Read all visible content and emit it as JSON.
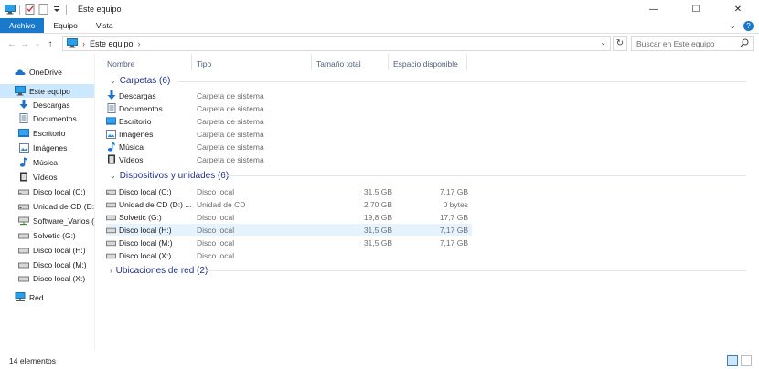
{
  "window": {
    "title": "Este equipo",
    "controls": {
      "minimize": "—",
      "maximize": "☐",
      "close": "✕"
    }
  },
  "ribbon": {
    "tabs": [
      {
        "label": "Archivo",
        "active": true
      },
      {
        "label": "Equipo",
        "active": false
      },
      {
        "label": "Vista",
        "active": false
      }
    ],
    "help": "?"
  },
  "address": {
    "path": "Este equipo",
    "separator": "›",
    "search_placeholder": "Buscar en Este equipo"
  },
  "nav": {
    "items": [
      {
        "label": "OneDrive",
        "icon": "cloud-icon"
      },
      {
        "label": "Este equipo",
        "icon": "computer-icon",
        "selected": true
      },
      {
        "label": "Descargas",
        "icon": "download-icon"
      },
      {
        "label": "Documentos",
        "icon": "document-icon"
      },
      {
        "label": "Escritorio",
        "icon": "desktop-icon"
      },
      {
        "label": "Imágenes",
        "icon": "picture-icon"
      },
      {
        "label": "Música",
        "icon": "music-icon"
      },
      {
        "label": "Vídeos",
        "icon": "video-icon"
      },
      {
        "label": "Disco local (C:)",
        "icon": "drive-icon"
      },
      {
        "label": "Unidad de CD (D:) C",
        "icon": "drive-icon"
      },
      {
        "label": "Software_Varios (\\\\v",
        "icon": "network-drive-icon"
      },
      {
        "label": "Solvetic (G:)",
        "icon": "drive-icon"
      },
      {
        "label": "Disco local (H:)",
        "icon": "drive-icon"
      },
      {
        "label": "Disco local (M:)",
        "icon": "drive-icon"
      },
      {
        "label": "Disco local (X:)",
        "icon": "drive-icon"
      },
      {
        "label": "Red",
        "icon": "network-icon"
      }
    ]
  },
  "columns": {
    "name": "Nombre",
    "type": "Tipo",
    "total": "Tamaño total",
    "free": "Espacio disponible"
  },
  "groups": {
    "folders": {
      "title": "Carpetas (6)",
      "items": [
        {
          "name": "Descargas",
          "type": "Carpeta de sistema",
          "icon": "download-icon"
        },
        {
          "name": "Documentos",
          "type": "Carpeta de sistema",
          "icon": "document-icon"
        },
        {
          "name": "Escritorio",
          "type": "Carpeta de sistema",
          "icon": "desktop-icon"
        },
        {
          "name": "Imágenes",
          "type": "Carpeta de sistema",
          "icon": "picture-icon"
        },
        {
          "name": "Música",
          "type": "Carpeta de sistema",
          "icon": "music-icon"
        },
        {
          "name": "Vídeos",
          "type": "Carpeta de sistema",
          "icon": "video-icon"
        }
      ]
    },
    "devices": {
      "title": "Dispositivos y unidades (6)",
      "items": [
        {
          "name": "Disco local (C:)",
          "type": "Disco local",
          "total": "31,5 GB",
          "free": "7,17 GB"
        },
        {
          "name": "Unidad de CD (D:) ...",
          "type": "Unidad de CD",
          "total": "2,70 GB",
          "free": "0 bytes"
        },
        {
          "name": "Solvetic (G:)",
          "type": "Disco local",
          "total": "19,8 GB",
          "free": "17,7 GB"
        },
        {
          "name": "Disco local (H:)",
          "type": "Disco local",
          "total": "31,5 GB",
          "free": "7,17 GB"
        },
        {
          "name": "Disco local (M:)",
          "type": "Disco local",
          "total": "31,5 GB",
          "free": "7,17 GB"
        },
        {
          "name": "Disco local (X:)",
          "type": "Disco local",
          "total": "",
          "free": ""
        }
      ]
    },
    "network": {
      "title": "Ubicaciones de red (2)"
    }
  },
  "status": {
    "count": "14 elementos"
  }
}
